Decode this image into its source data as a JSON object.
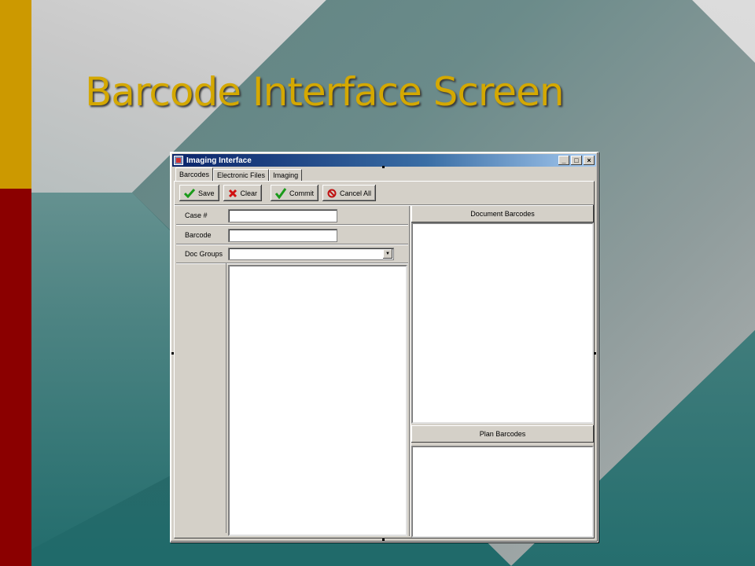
{
  "slide": {
    "title": "Barcode Interface Screen"
  },
  "window": {
    "title": "Imaging Interface",
    "controls": {
      "minimize": "_",
      "maximize": "□",
      "close": "×"
    }
  },
  "tabs": [
    "Barcodes",
    "Electronic Files",
    "Imaging"
  ],
  "toolbar": {
    "save_label": "Save",
    "clear_label": "Clear",
    "commit_label": "Commit",
    "cancel_all_label": "Cancel All"
  },
  "form": {
    "case_label": "Case #",
    "case_value": "",
    "barcode_label": "Barcode",
    "barcode_value": "",
    "doc_groups_label": "Doc Groups",
    "doc_groups_value": ""
  },
  "panels": {
    "document_barcodes": "Document Barcodes",
    "plan_barcodes": "Plan Barcodes"
  },
  "colors": {
    "title_gold": "#d4a800",
    "bar_gold": "#cc9900",
    "bar_red": "#8b0000",
    "titlebar_blue": "#0a246a",
    "window_face": "#d4d0c8"
  },
  "icons": {
    "save": "green-check-icon",
    "clear": "red-x-icon",
    "commit": "green-check-icon",
    "cancel_all": "no-entry-icon"
  }
}
